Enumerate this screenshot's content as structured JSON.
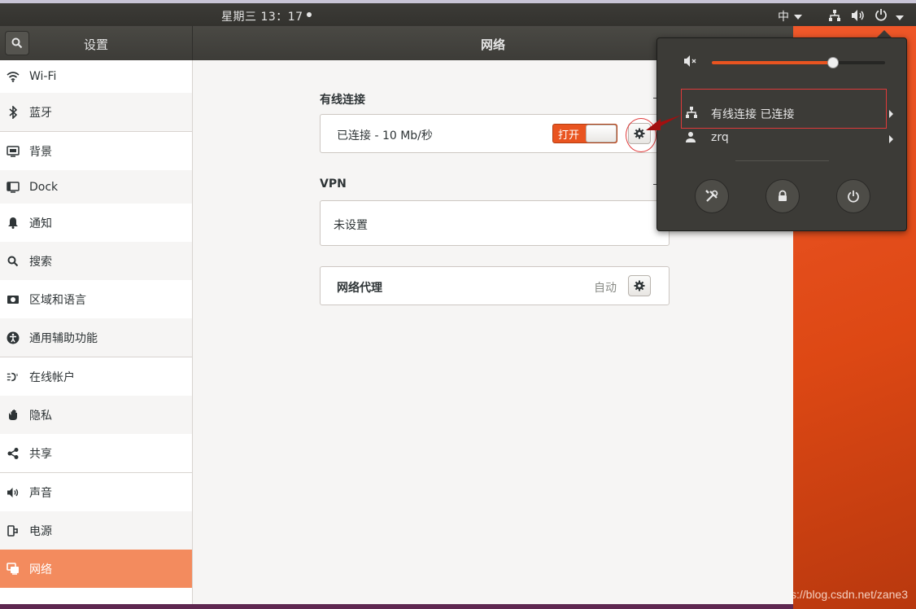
{
  "topbar": {
    "clock": "星期三 13：17",
    "input_method": "中"
  },
  "window": {
    "sidebar_title": "设置",
    "main_title": "网络"
  },
  "sidebar": {
    "items": [
      {
        "label": "Wi-Fi",
        "icon": "wifi-icon"
      },
      {
        "label": "蓝牙",
        "icon": "bluetooth-icon"
      },
      {
        "label": "背景",
        "icon": "background-icon"
      },
      {
        "label": "Dock",
        "icon": "dock-icon"
      },
      {
        "label": "通知",
        "icon": "bell-icon"
      },
      {
        "label": "搜索",
        "icon": "search-icon"
      },
      {
        "label": "区域和语言",
        "icon": "region-icon"
      },
      {
        "label": "通用辅助功能",
        "icon": "accessibility-icon"
      },
      {
        "label": "在线帐户",
        "icon": "online-accounts-icon"
      },
      {
        "label": "隐私",
        "icon": "privacy-hand-icon"
      },
      {
        "label": "共享",
        "icon": "share-icon"
      },
      {
        "label": "声音",
        "icon": "speaker-icon"
      },
      {
        "label": "电源",
        "icon": "power-plug-icon"
      },
      {
        "label": "网络",
        "icon": "network-icon"
      }
    ],
    "active_index": 13
  },
  "content": {
    "wired": {
      "title": "有线连接",
      "status": "已连接 - 10 Mb/秒",
      "switch_label": "打开"
    },
    "vpn": {
      "title": "VPN",
      "value": "未设置"
    },
    "proxy": {
      "label": "网络代理",
      "value": "自动"
    }
  },
  "menu": {
    "volume_level": 0.7,
    "wired_label": "有线连接 已连接",
    "user_label": "zrq"
  },
  "watermark": "https://blog.csdn.net/zane3",
  "colors": {
    "accent": "#e95420",
    "active_sidebar": "#f38b5e",
    "annotation": "#e03a3a"
  }
}
